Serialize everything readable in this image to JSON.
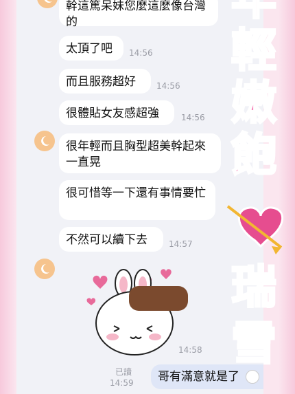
{
  "messages": [
    {
      "text": "幹這篤呆妹您麼這麼像台灣的",
      "time": ""
    },
    {
      "text": "太頂了吧",
      "time": "14:56"
    },
    {
      "text": "而且服務超好",
      "time": "14:56"
    },
    {
      "text": "很體貼女友感超強",
      "time": "14:56"
    },
    {
      "text": "很年輕而且胸型超美幹起來一直晃",
      "time": ""
    },
    {
      "text": "很可惜等一下還有事情要忙",
      "time": ""
    },
    {
      "text": "不然可以續下去",
      "time": "14:57"
    }
  ],
  "sticker": {
    "time": "14:58"
  },
  "outgoing": {
    "read": "已讀",
    "time": "14:59",
    "text": "哥有滿意就是了"
  },
  "decor": {
    "chars": [
      "年",
      "輕",
      "嫩",
      "飽",
      "瑞",
      "雪"
    ]
  },
  "colors": {
    "bubble": "#ffffff",
    "outgoing": "#dfe6f7",
    "pink": "#f06aa6",
    "avatar": "#f6c48e"
  }
}
